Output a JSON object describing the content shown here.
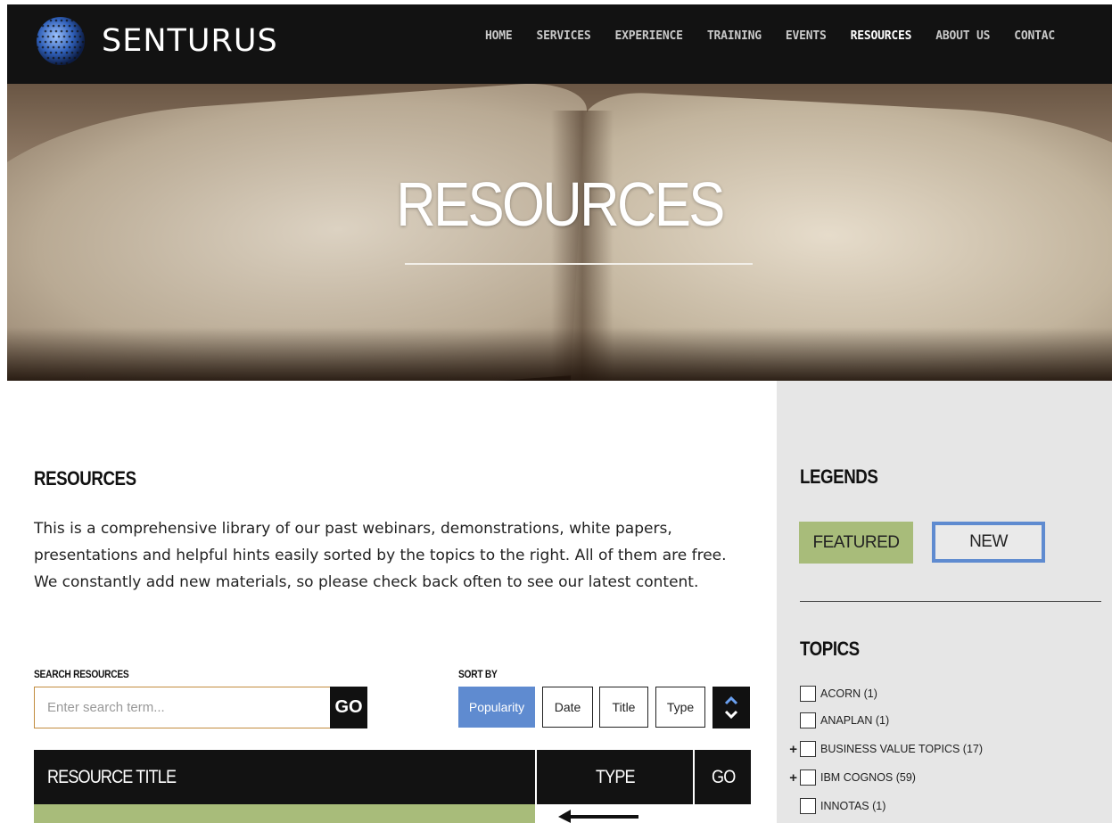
{
  "header": {
    "brand": "SENTURUS",
    "nav": [
      "HOME",
      "SERVICES",
      "EXPERIENCE",
      "TRAINING",
      "EVENTS",
      "RESOURCES",
      "ABOUT US",
      "CONTAC"
    ],
    "active_nav": "RESOURCES"
  },
  "hero": {
    "title": "RESOURCES"
  },
  "main": {
    "heading": "RESOURCES",
    "intro": "This is a comprehensive library of our past webinars, demonstrations, white papers, presentations and helpful hints easily sorted by the topics to the right. All of them are free. We constantly add new materials, so please check back often to see our latest content.",
    "search": {
      "label": "SEARCH RESOURCES",
      "placeholder": "Enter search term...",
      "go": "GO"
    },
    "sort": {
      "label": "SORT BY",
      "options": [
        "Popularity",
        "Date",
        "Title",
        "Type"
      ],
      "selected": "Popularity"
    },
    "table": {
      "columns": [
        "RESOURCE TITLE",
        "TYPE",
        "GO"
      ]
    }
  },
  "sidebar": {
    "legends_heading": "LEGENDS",
    "legend_featured": "FEATURED",
    "legend_new": "NEW",
    "topics_heading": "TOPICS",
    "topics": [
      {
        "label": "ACORN (1)",
        "expandable": false
      },
      {
        "label": "ANAPLAN (1)",
        "expandable": false
      },
      {
        "label": "BUSINESS VALUE TOPICS (17)",
        "expandable": true
      },
      {
        "label": "IBM COGNOS (59)",
        "expandable": true
      },
      {
        "label": "INNOTAS (1)",
        "expandable": false
      }
    ]
  },
  "colors": {
    "featured": "#a8bc7a",
    "new_border": "#5f8bd0",
    "active_sort": "#5f8bd0",
    "header_bg": "#121212"
  },
  "icons": [
    "globe-logo-icon",
    "sort-arrows-icon",
    "arrow-left-icon",
    "plus-icon",
    "checkbox"
  ]
}
